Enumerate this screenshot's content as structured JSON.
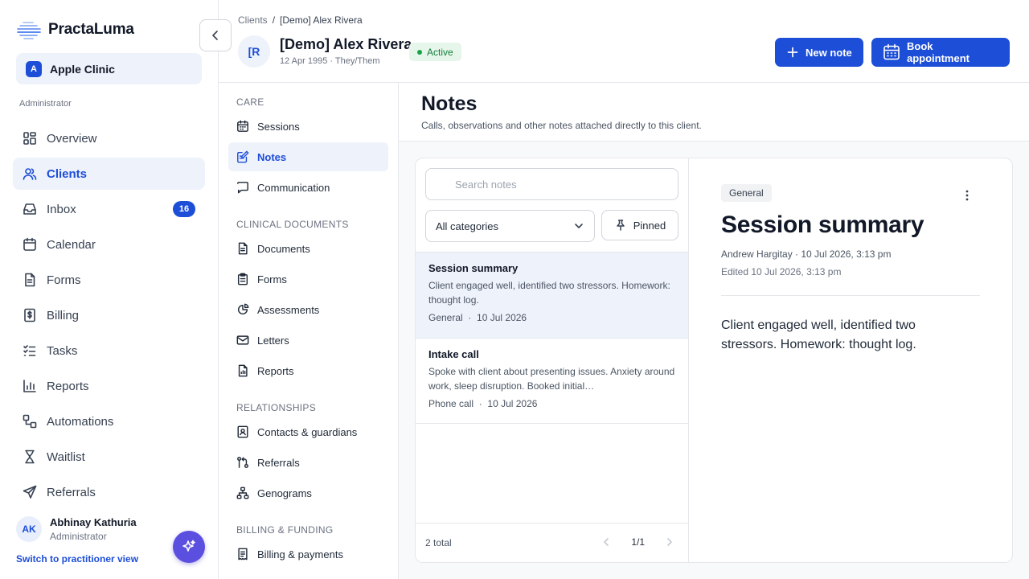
{
  "brand": {
    "name": "PractaLuma"
  },
  "clinic": {
    "badge": "A",
    "name": "Apple Clinic"
  },
  "sidebar": {
    "role": "Administrator",
    "items": [
      {
        "label": "Overview",
        "icon": "overview-icon"
      },
      {
        "label": "Clients",
        "icon": "users-icon",
        "active": true
      },
      {
        "label": "Inbox",
        "icon": "inbox-icon",
        "badge": "16"
      },
      {
        "label": "Calendar",
        "icon": "calendar-icon"
      },
      {
        "label": "Forms",
        "icon": "forms-icon"
      },
      {
        "label": "Billing",
        "icon": "billing-icon"
      },
      {
        "label": "Tasks",
        "icon": "tasks-icon"
      },
      {
        "label": "Reports",
        "icon": "reports-icon"
      },
      {
        "label": "Automations",
        "icon": "automations-icon"
      },
      {
        "label": "Waitlist",
        "icon": "hourglass-icon"
      },
      {
        "label": "Referrals",
        "icon": "send-icon"
      }
    ],
    "user": {
      "initials": "AK",
      "name": "Abhinay Kathuria",
      "role": "Administrator"
    },
    "switch_link": "Switch to practitioner view"
  },
  "header": {
    "breadcrumb": {
      "parent": "Clients",
      "separator": "/",
      "current": "[Demo] Alex Rivera"
    },
    "client": {
      "initials": "[R",
      "name": "[Demo] Alex Rivera",
      "meta": "12 Apr 1995 · They/Them",
      "status": "Active"
    },
    "new_note_label": "New note",
    "book_label": "Book appointment"
  },
  "subnav": {
    "sections": [
      {
        "title": "CARE",
        "items": [
          {
            "label": "Sessions",
            "icon": "calendar-icon"
          },
          {
            "label": "Notes",
            "icon": "notes-icon",
            "active": true
          },
          {
            "label": "Communication",
            "icon": "chat-icon"
          }
        ]
      },
      {
        "title": "CLINICAL DOCUMENTS",
        "items": [
          {
            "label": "Documents",
            "icon": "document-icon"
          },
          {
            "label": "Forms",
            "icon": "clipboard-icon"
          },
          {
            "label": "Assessments",
            "icon": "assessment-icon"
          },
          {
            "label": "Letters",
            "icon": "mail-icon"
          },
          {
            "label": "Reports",
            "icon": "report-icon"
          }
        ]
      },
      {
        "title": "RELATIONSHIPS",
        "items": [
          {
            "label": "Contacts & guardians",
            "icon": "contact-icon"
          },
          {
            "label": "Referrals",
            "icon": "referral-icon"
          },
          {
            "label": "Genograms",
            "icon": "genogram-icon"
          }
        ]
      },
      {
        "title": "BILLING & FUNDING",
        "items": [
          {
            "label": "Billing & payments",
            "icon": "billing-icon"
          }
        ]
      }
    ]
  },
  "main": {
    "title": "Notes",
    "subtitle": "Calls, observations and other notes attached directly to this client.",
    "search": {
      "placeholder": "Search notes"
    },
    "category_filter": "All categories",
    "pinned_label": "Pinned",
    "notes": [
      {
        "title": "Session summary",
        "body": "Client engaged well, identified two stressors. Homework: thought log.",
        "category": "General",
        "date": "10 Jul 2026",
        "dot": "·",
        "selected": true
      },
      {
        "title": "Intake call",
        "body": "Spoke with client about presenting issues. Anxiety around work, sleep disruption. Booked initial…",
        "category": "Phone call",
        "date": "10 Jul 2026",
        "dot": "·"
      }
    ],
    "total": "2 total",
    "page": "1/1",
    "detail": {
      "tag": "General",
      "title": "Session summary",
      "author_line": "Andrew Hargitay · 10 Jul 2026, 3:13 pm",
      "edited_line": "Edited 10 Jul 2026, 3:13 pm",
      "body": "Client engaged well, identified two stressors. Homework: thought log."
    }
  },
  "colors": {
    "accent": "#1d4ed8",
    "active_bg": "#eef2fb",
    "status_green": "#16a34a",
    "fab": "#5b4fe0"
  }
}
